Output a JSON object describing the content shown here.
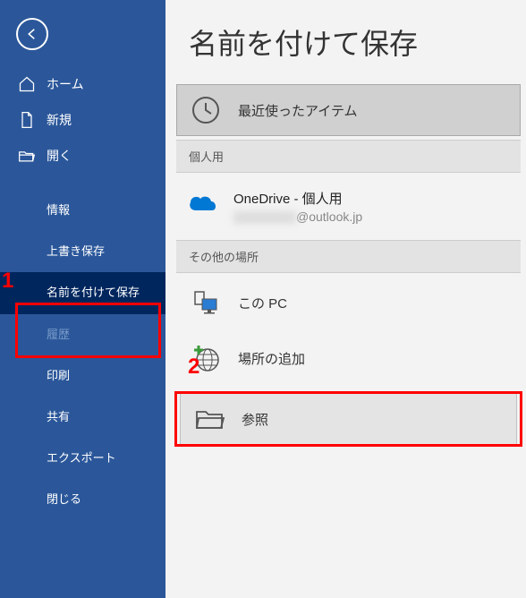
{
  "sidebar": {
    "home": "ホーム",
    "new": "新規",
    "open": "開く",
    "info": "情報",
    "save": "上書き保存",
    "saveas": "名前を付けて保存",
    "history": "履歴",
    "print": "印刷",
    "share": "共有",
    "export": "エクスポート",
    "close": "閉じる"
  },
  "main": {
    "title": "名前を付けて保存",
    "recent": "最近使ったアイテム",
    "section_personal": "個人用",
    "onedrive_label": "OneDrive - 個人用",
    "onedrive_email_suffix": "@outlook.jp",
    "section_other": "その他の場所",
    "this_pc": "この PC",
    "add_place": "場所の追加",
    "browse": "参照"
  },
  "annotations": {
    "one": "1",
    "two": "2"
  }
}
